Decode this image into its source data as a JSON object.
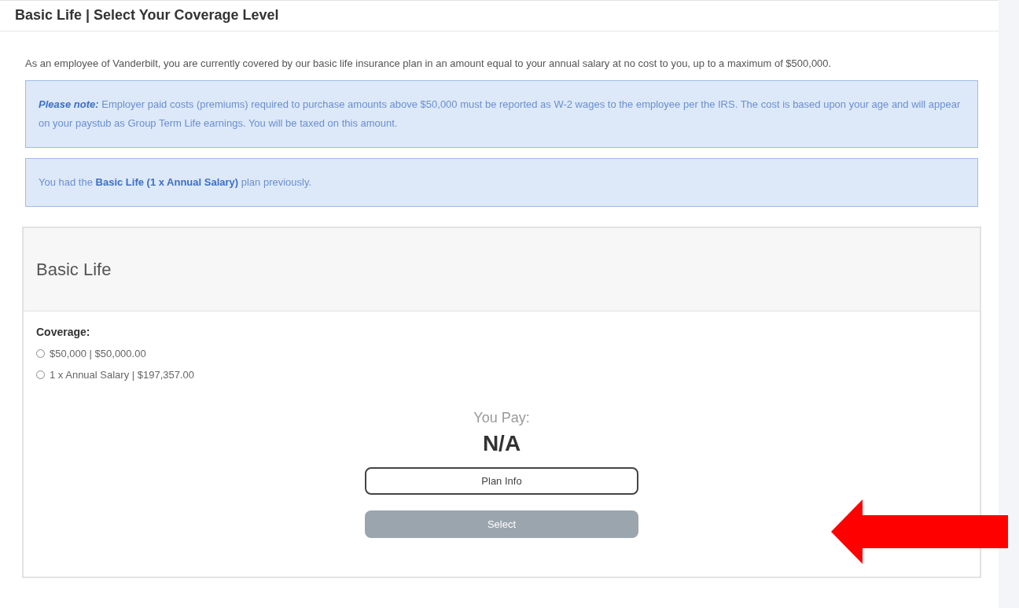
{
  "page_title": "Basic Life | Select Your Coverage Level",
  "intro": "As an employee of Vanderbilt, you are currently covered by our basic life insurance plan in an amount equal to your annual salary at no cost to you, up to a maximum of $500,000.",
  "notices": [
    {
      "label": "Please note:",
      "text": "Employer paid costs (premiums) required to purchase amounts above $50,000 must be reported as W-2 wages to the employee per the IRS. The cost is based upon your age and will appear on your paystub as Group Term Life earnings. You will be taxed on this amount."
    },
    {
      "text": "You had the **Basic Life (1 x Annual Salary)** plan previously."
    }
  ],
  "plan": {
    "title": "Basic Life",
    "coverage_label": "Coverage:",
    "options": [
      {
        "label": "$50,000 | $50,000.00",
        "selected": false
      },
      {
        "label": "1 x Annual Salary | $197,357.00",
        "selected": false
      }
    ],
    "you_pay_label": "You Pay:",
    "you_pay_value": "N/A",
    "buttons": [
      {
        "label": "Plan Info",
        "kind": "outline",
        "disabled": false
      },
      {
        "label": "Select",
        "kind": "filled",
        "disabled": true
      }
    ]
  }
}
